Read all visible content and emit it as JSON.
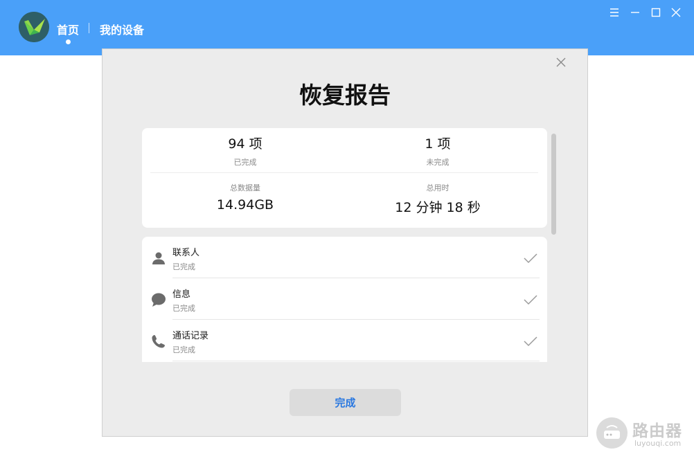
{
  "header": {
    "nav": {
      "home": "首页",
      "my_devices": "我的设备"
    },
    "window_controls": [
      "menu-icon",
      "minimize-icon",
      "maximize-icon",
      "close-icon"
    ]
  },
  "dialog": {
    "title": "恢复报告",
    "summary": {
      "completed_count": "94 项",
      "completed_label": "已完成",
      "incomplete_count": "1 项",
      "incomplete_label": "未完成",
      "data_size_label": "总数据量",
      "data_size": "14.94GB",
      "time_label": "总用时",
      "time": "12 分钟 18 秒"
    },
    "items": [
      {
        "name": "联系人",
        "status": "已完成",
        "icon": "person-icon"
      },
      {
        "name": "信息",
        "status": "已完成",
        "icon": "message-icon"
      },
      {
        "name": "通话记录",
        "status": "已完成",
        "icon": "phone-icon"
      }
    ],
    "done_button": "完成"
  },
  "watermark": {
    "text": "路由器",
    "url": "luyouqi.com"
  },
  "colors": {
    "header_bg": "#4aa0f9",
    "dialog_bg": "#ececec",
    "accent_button_text": "#2a78e0"
  }
}
